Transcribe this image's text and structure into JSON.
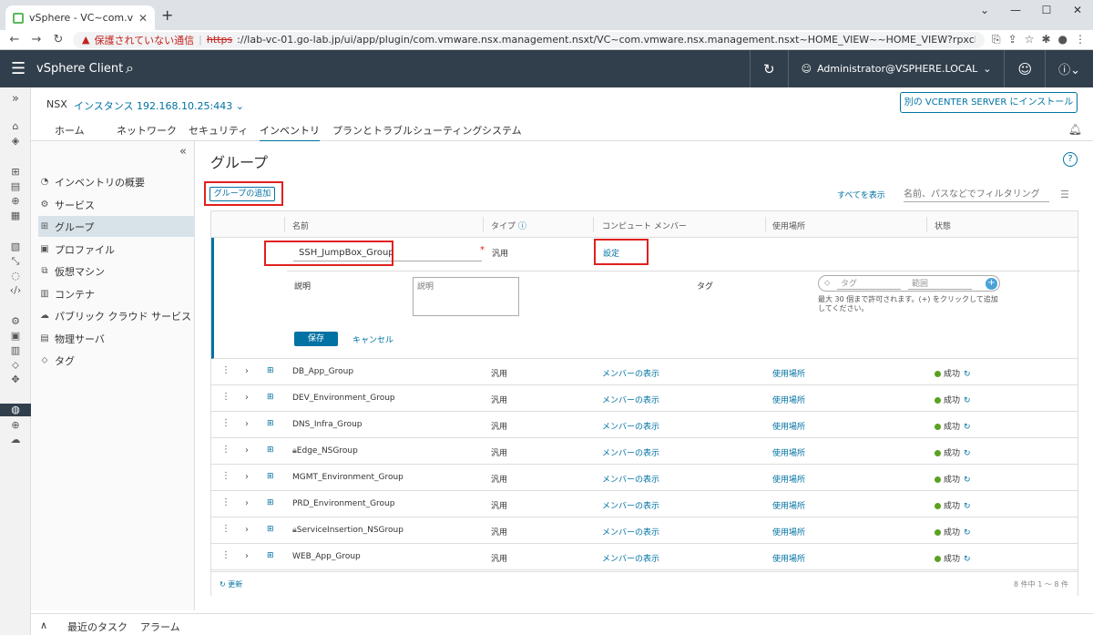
{
  "browser": {
    "tab_title": "vSphere - VC~com.vmware.nsx.m",
    "security_warning": "保護されていない通信",
    "url_scheme": "https",
    "url_rest": "://lab-vc-01.go-lab.jp/ui/app/plugin/com.vmware.nsx.management.nsxt/VC~com.vmware.nsx.management.nsxt~HOME_VIEW~~HOME_VIEW?rpxcId=com.vmware.nsx.management.nsxt:3.2.0.1:-5535..."
  },
  "header": {
    "app_title": "vSphere Client",
    "user": "Administrator@VSPHERE.LOCAL"
  },
  "nsx": {
    "label": "NSX",
    "instance": "インスタンス 192.168.10.25:443",
    "install_button": "別の VCENTER SERVER にインストール"
  },
  "tabs": [
    {
      "label": "ホーム"
    },
    {
      "label": "ネットワーク"
    },
    {
      "label": "セキュリティ"
    },
    {
      "label": "インベントリ"
    },
    {
      "label": "プランとトラブルシューティング"
    },
    {
      "label": "システム"
    }
  ],
  "sidebar": {
    "items": [
      {
        "label": "インベントリの概要"
      },
      {
        "label": "サービス"
      },
      {
        "label": "グループ"
      },
      {
        "label": "プロファイル"
      },
      {
        "label": "仮想マシン"
      },
      {
        "label": "コンテナ"
      },
      {
        "label": "パブリック クラウド サービス"
      },
      {
        "label": "物理サーバ"
      },
      {
        "label": "タグ"
      }
    ]
  },
  "main": {
    "title": "グループ",
    "add_button": "グループの追加",
    "show_all": "すべてを表示",
    "filter_placeholder": "名前、パスなどでフィルタリング",
    "columns": {
      "name": "名前",
      "type": "タイプ",
      "members": "コンピュート メンバー",
      "where_used": "使用場所",
      "status": "状態"
    },
    "edit": {
      "name_value": "SSH_JumpBox_Group",
      "type": "汎用",
      "members_link": "設定",
      "description_label": "説明",
      "description_placeholder": "説明",
      "tag_label": "タグ",
      "tag_placeholder": "タグ",
      "scope_placeholder": "範囲",
      "tag_hint": "最大 30 個まで許可されます。(+) をクリックして追加してください。",
      "save": "保存",
      "cancel": "キャンセル"
    },
    "rows": [
      {
        "name": "DB_App_Group",
        "locked": false,
        "type": "汎用",
        "members": "メンバーの表示",
        "where_used": "使用場所",
        "status": "成功"
      },
      {
        "name": "DEV_Environment_Group",
        "locked": false,
        "type": "汎用",
        "members": "メンバーの表示",
        "where_used": "使用場所",
        "status": "成功"
      },
      {
        "name": "DNS_Infra_Group",
        "locked": false,
        "type": "汎用",
        "members": "メンバーの表示",
        "where_used": "使用場所",
        "status": "成功"
      },
      {
        "name": "Edge_NSGroup",
        "locked": true,
        "type": "汎用",
        "members": "メンバーの表示",
        "where_used": "使用場所",
        "status": "成功"
      },
      {
        "name": "MGMT_Environment_Group",
        "locked": false,
        "type": "汎用",
        "members": "メンバーの表示",
        "where_used": "使用場所",
        "status": "成功"
      },
      {
        "name": "PRD_Environment_Group",
        "locked": false,
        "type": "汎用",
        "members": "メンバーの表示",
        "where_used": "使用場所",
        "status": "成功"
      },
      {
        "name": "ServiceInsertion_NSGroup",
        "locked": true,
        "type": "汎用",
        "members": "メンバーの表示",
        "where_used": "使用場所",
        "status": "成功"
      },
      {
        "name": "WEB_App_Group",
        "locked": false,
        "type": "汎用",
        "members": "メンバーの表示",
        "where_used": "使用場所",
        "status": "成功"
      }
    ],
    "refresh": "更新",
    "pager": "8 件中 1 ～ 8 件"
  },
  "bottom": {
    "recent_tasks": "最近のタスク",
    "alarms": "アラーム"
  }
}
